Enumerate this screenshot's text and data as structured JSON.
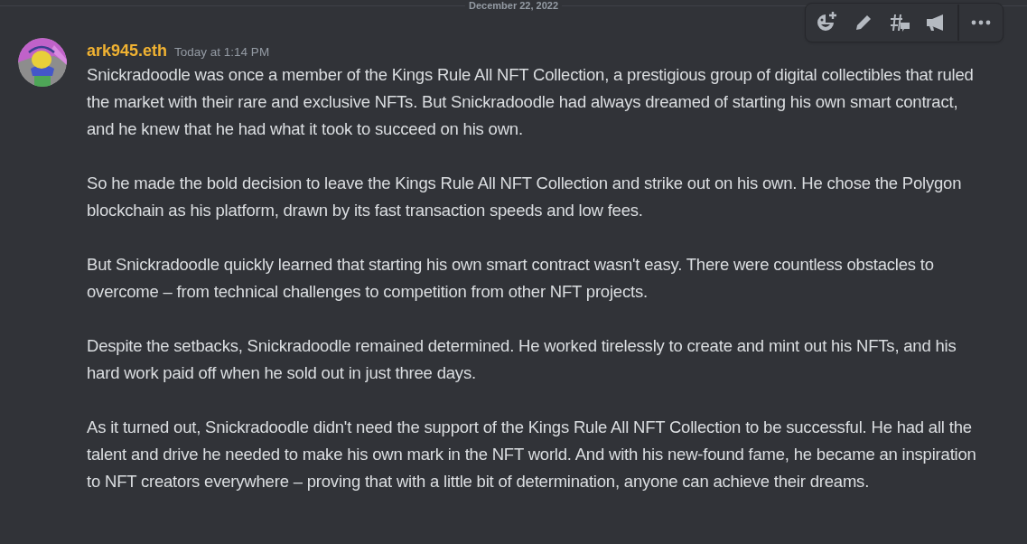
{
  "date_divider": "December 22, 2022",
  "message": {
    "author": "ark945.eth",
    "timestamp": "Today at 1:14 PM",
    "paragraphs": [
      "Snickradoodle was once a member of the Kings Rule All NFT Collection, a prestigious group of digital collectibles that ruled the market with their rare and exclusive NFTs. But Snickradoodle had always dreamed of starting his own smart contract, and he knew that he had what it took to succeed on his own.",
      "So he made the bold decision to leave the Kings Rule All NFT Collection and strike out on his own. He chose the Polygon blockchain as his platform, drawn by its fast transaction speeds and low fees.",
      "But Snickradoodle quickly learned that starting his own smart contract wasn't easy. There were countless obstacles to overcome – from technical challenges to competition from other NFT projects.",
      "Despite the setbacks, Snickradoodle remained determined. He worked tirelessly to create and mint out his NFTs, and his hard work paid off when he sold out in just three days.",
      "As it turned out, Snickradoodle didn't need the support of the Kings Rule All NFT Collection to be successful. He had all the talent and drive he needed to make his own mark in the NFT world. And with his new-found fame, he became an inspiration to NFT creators everywhere – proving that with a little bit of determination, anyone can achieve their dreams."
    ]
  }
}
